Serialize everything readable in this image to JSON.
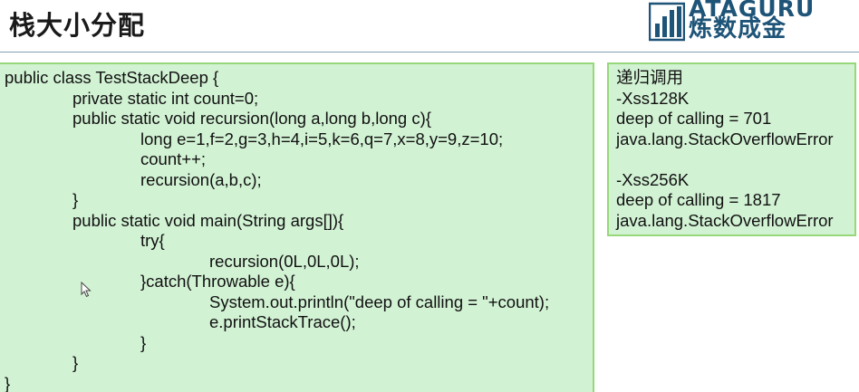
{
  "slide": {
    "title": "栈大小分配"
  },
  "logo": {
    "latin": "ATAGURU",
    "cjk": "炼数成金",
    "icon": "bar-chart-logo-icon",
    "color": "#1e5478"
  },
  "code_panel": {
    "lines": [
      "public class TestStackDeep {",
      "private static int count=0;",
      "public static void recursion(long a,long b,long c){",
      "long e=1,f=2,g=3,h=4,i=5,k=6,q=7,x=8,y=9,z=10;",
      "count++;",
      "recursion(a,b,c);",
      "}",
      "public static void main(String args[]){",
      "try{",
      "recursion(0L,0L,0L);",
      "}catch(Throwable e){",
      "System.out.println(\"deep of calling = \"+count);",
      "e.printStackTrace();",
      "}",
      "}",
      "}"
    ],
    "background": "#d2f2d4",
    "border": "#97d87a"
  },
  "result_panel": {
    "lines": [
      "递归调用",
      "-Xss128K",
      "deep of calling = 701",
      "java.lang.StackOverflowError",
      "",
      "-Xss256K",
      "deep of calling = 1817",
      "java.lang.StackOverflowError"
    ]
  },
  "cursor": {
    "icon": "mouse-pointer-icon"
  }
}
